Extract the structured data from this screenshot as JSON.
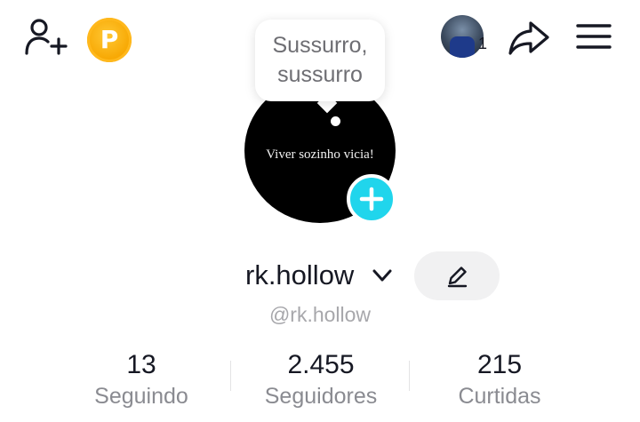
{
  "header": {
    "coin_letter": "P",
    "story_count": "1",
    "icons": [
      "add-friend-icon",
      "coin-icon",
      "share-icon",
      "menu-icon"
    ]
  },
  "profile": {
    "avatar_text": "Viver sozinho vicia!",
    "note": "Sussurro, sussurro",
    "display_name": "rk.hollow",
    "username": "@rk.hollow"
  },
  "stats": [
    {
      "value": "13",
      "label": "Seguindo"
    },
    {
      "value": "2.455",
      "label": "Seguidores"
    },
    {
      "value": "215",
      "label": "Curtidas"
    }
  ],
  "colors": {
    "accent_add": "#20d5ec",
    "coin": "#f7a600",
    "text_primary": "#161823",
    "text_secondary": "#8a8b91"
  }
}
